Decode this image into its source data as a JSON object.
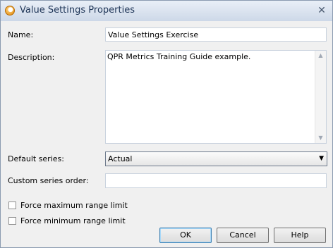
{
  "window": {
    "title": "Value Settings Properties",
    "close_symbol": "✕"
  },
  "form": {
    "name_label": "Name:",
    "name_value": "Value Settings Exercise",
    "description_label": "Description:",
    "description_value": "QPR Metrics Training Guide example.",
    "default_series_label": "Default series:",
    "default_series_value": "Actual",
    "custom_series_order_label": "Custom series order:",
    "custom_series_order_value": "",
    "force_max_label": "Force maximum range limit",
    "force_max_checked": false,
    "force_min_label": "Force minimum range limit",
    "force_min_checked": false
  },
  "buttons": {
    "ok": "OK",
    "cancel": "Cancel",
    "help": "Help"
  },
  "icons": {
    "app": "qpr-app-icon",
    "close": "close-icon",
    "scroll_up": "scroll-up-arrow-icon",
    "scroll_down": "scroll-down-arrow-icon",
    "dropdown": "chevron-down-icon"
  }
}
